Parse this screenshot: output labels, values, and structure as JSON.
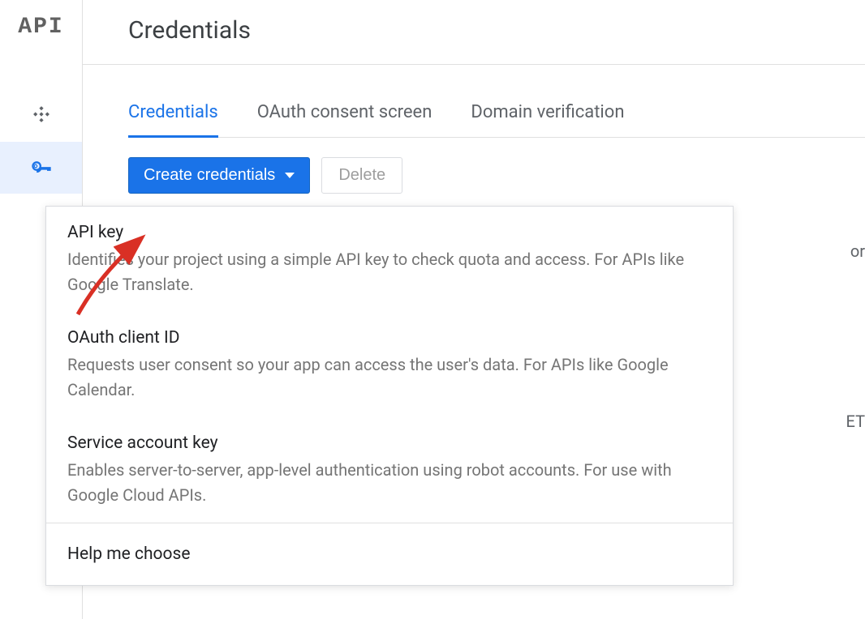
{
  "sidebar": {
    "logo_text": "API",
    "items": [
      {
        "name": "dashboard",
        "active": false
      },
      {
        "name": "credentials",
        "active": true
      }
    ]
  },
  "header": {
    "title": "Credentials"
  },
  "tabs": [
    {
      "label": "Credentials",
      "active": true
    },
    {
      "label": "OAuth consent screen",
      "active": false
    },
    {
      "label": "Domain verification",
      "active": false
    }
  ],
  "toolbar": {
    "create_label": "Create credentials",
    "delete_label": "Delete"
  },
  "dropdown": {
    "items": [
      {
        "title": "API key",
        "desc": "Identifies your project using a simple API key to check quota and access. For APIs like Google Translate."
      },
      {
        "title": "OAuth client ID",
        "desc": "Requests user consent so your app can access the user's data. For APIs like Google Calendar."
      },
      {
        "title": "Service account key",
        "desc": "Enables server-to-server, app-level authentication using robot accounts. For use with Google Cloud APIs."
      }
    ],
    "footer": "Help me choose"
  },
  "obscured": {
    "text1": "or",
    "text2": "ET"
  },
  "colors": {
    "primary": "#1a73e8",
    "text": "#3c4043",
    "muted": "#757575",
    "annotation": "#d93025"
  }
}
